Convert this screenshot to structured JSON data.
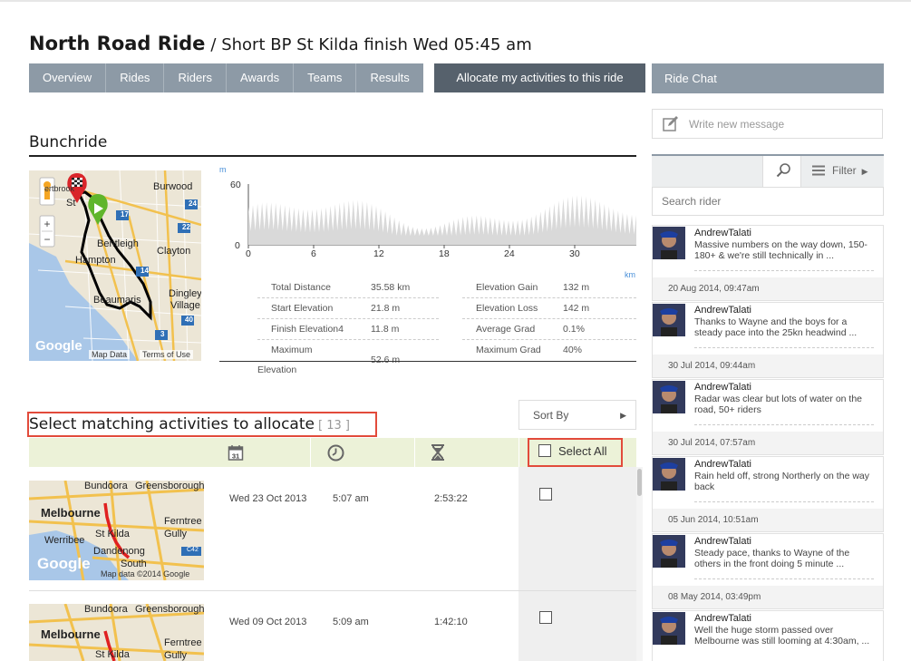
{
  "header": {
    "title": "North Road Ride",
    "subtitle": "/ Short BP St Kilda finish Wed 05:45 am"
  },
  "tabs": [
    "Overview",
    "Rides",
    "Riders",
    "Awards",
    "Teams",
    "Results"
  ],
  "active_tab": "Allocate my activities to this ride",
  "chat_tab": "Ride Chat",
  "bunchride": {
    "title": "Bunchride",
    "map": {
      "labels": [
        "Burwood",
        "St",
        "Bentleigh",
        "Clayton",
        "Hampton",
        "Beaumaris",
        "Dingley",
        "Village",
        "ertbrook"
      ],
      "road_numbers": [
        "17",
        "24",
        "14",
        "40",
        "3",
        "22"
      ],
      "credits": {
        "logo": "Google",
        "data": "Map Data",
        "terms": "Terms of Use"
      }
    },
    "elevation_chart": {
      "y_unit": "m",
      "x_unit": "km",
      "y_ticks": [
        "60",
        "0"
      ],
      "x_ticks": [
        "0",
        "6",
        "12",
        "18",
        "24",
        "30"
      ]
    },
    "stats": {
      "total_distance_label": "Total Distance",
      "total_distance": "35.58 km",
      "start_elevation_label": "Start Elevation",
      "start_elevation": "21.8 m",
      "finish_elevation_label": "Finish Elevation4",
      "finish_elevation": "11.8 m",
      "max_elevation_label_1": "Maximum",
      "max_elevation_label_2": "Elevation",
      "max_elevation": "52.6 m",
      "elevation_gain_label": "Elevation Gain",
      "elevation_gain": "132 m",
      "elevation_loss_label": "Elevation Loss",
      "elevation_loss": "142 m",
      "average_grad_label": "Average Grad",
      "average_grad": "0.1%",
      "maximum_grad_label": "Maximum Grad",
      "maximum_grad": "40%"
    }
  },
  "allocate": {
    "title": "Select matching activities to allocate",
    "count": "[ 13 ]",
    "sort_by": "Sort By",
    "select_all": "Select All",
    "calendar_day": "31",
    "rows": [
      {
        "date": "Wed 23 Oct 2013",
        "start": "5:07 am",
        "duration": "2:53:22",
        "map": {
          "labels": [
            "Bundoora",
            "Greensborough",
            "Melbourne",
            "Ferntree",
            "Gully",
            "Werribee",
            "St Kilda",
            "Dandenong",
            "South"
          ],
          "road": "C42",
          "logo": "Google",
          "credit": "Map data ©2014 Google"
        }
      },
      {
        "date": "Wed 09 Oct 2013",
        "start": "5:09 am",
        "duration": "1:42:10",
        "map": {
          "labels": [
            "Bundoora",
            "Greensborough",
            "Melbourne",
            "Ferntree",
            "Gully",
            "St Kilda"
          ]
        }
      }
    ]
  },
  "chat": {
    "new_message_placeholder": "Write new message",
    "filter_label": "Filter",
    "search_placeholder": "Search rider",
    "messages": [
      {
        "name": "AndrewTalati",
        "text": "Massive numbers on the way down, 150-180+ & we're still technically in ...",
        "date": "20 Aug 2014, 09:47am"
      },
      {
        "name": "AndrewTalati",
        "text": "Thanks to Wayne and the boys for a steady pace into the 25kn headwind ...",
        "date": "30 Jul 2014, 09:44am"
      },
      {
        "name": "AndrewTalati",
        "text": "Radar was clear but lots of water on the road, 50+ riders",
        "date": "30 Jul 2014, 07:57am"
      },
      {
        "name": "AndrewTalati",
        "text": "Rain held off, strong Northerly on the way back",
        "date": "05 Jun 2014, 10:51am"
      },
      {
        "name": "AndrewTalati",
        "text": "Steady pace, thanks to Wayne of the others in the front doing 5 minute ...",
        "date": "08 May 2014, 03:49pm"
      },
      {
        "name": "AndrewTalati",
        "text": "Well the huge storm passed over Melbourne was still looming at 4:30am, ...",
        "date": ""
      }
    ]
  },
  "colors": {
    "tab": "#8d9aa6",
    "tab_active": "#56616c",
    "highlight_border": "#e24b3b",
    "table_header": "#ecf2d8",
    "route": "#000000",
    "marker_start": "#5fb52b",
    "marker_finish": "#d9252a"
  }
}
